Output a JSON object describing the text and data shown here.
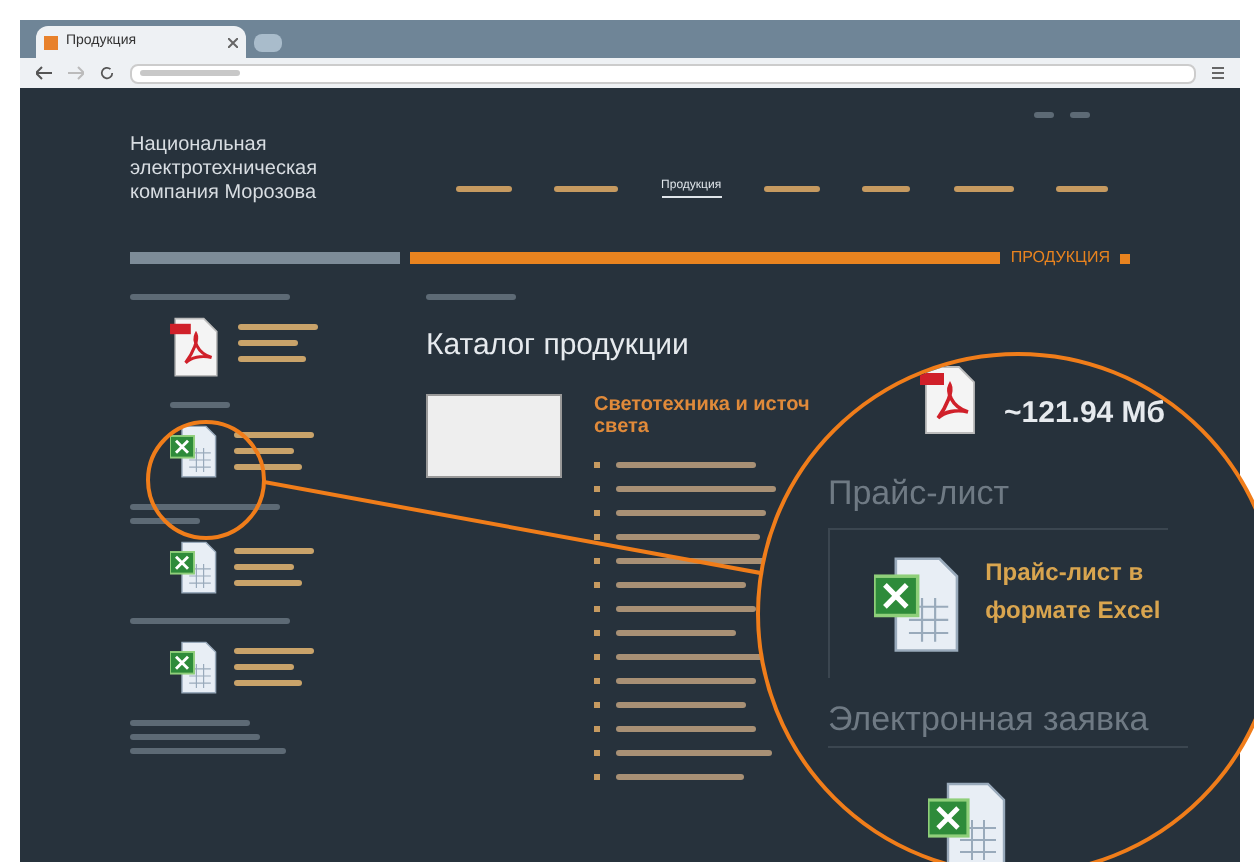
{
  "browser": {
    "tab_title": "Продукция"
  },
  "header": {
    "logo": "Национальная электротехническая компания Морозова",
    "nav": [
      {
        "label": "Продукция",
        "selected": true
      }
    ]
  },
  "banner": {
    "label": "ПРОДУКЦИЯ"
  },
  "catalog": {
    "title": "Каталог продукции",
    "category_lines": [
      "Светотехника и источ",
      "света"
    ]
  },
  "magnifier": {
    "file_size": "~121.94 Мб",
    "price_heading": "Прайс-лист",
    "price_link": "Прайс-лист в формате Excel",
    "order_heading": "Электронная заявка"
  }
}
